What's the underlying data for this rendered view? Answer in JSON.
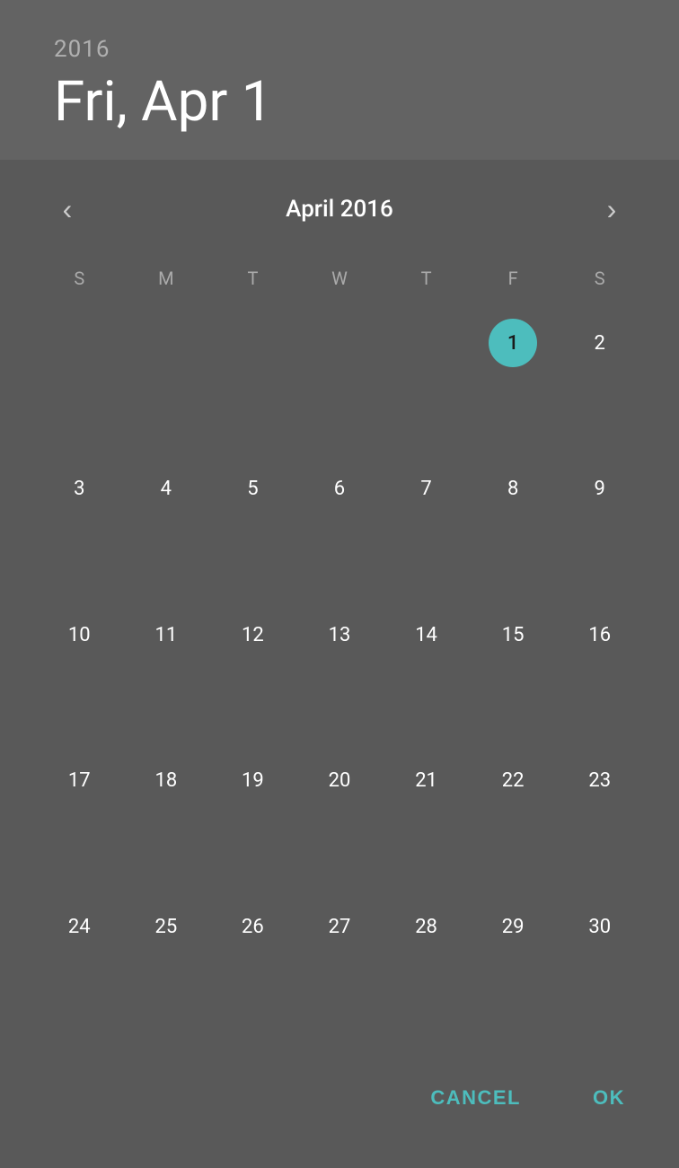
{
  "header": {
    "year": "2016",
    "date": "Fri, Apr 1"
  },
  "calendar": {
    "month_title": "April 2016",
    "day_headers": [
      "S",
      "M",
      "T",
      "W",
      "T",
      "F",
      "S"
    ],
    "prev_icon": "‹",
    "next_icon": "›",
    "selected_day": 1,
    "weeks": [
      [
        null,
        null,
        null,
        null,
        null,
        1,
        2
      ],
      [
        3,
        4,
        5,
        6,
        7,
        8,
        9
      ],
      [
        10,
        11,
        12,
        13,
        14,
        15,
        16
      ],
      [
        17,
        18,
        19,
        20,
        21,
        22,
        23
      ],
      [
        24,
        25,
        26,
        27,
        28,
        29,
        30
      ]
    ]
  },
  "footer": {
    "cancel_label": "CANCEL",
    "ok_label": "OK"
  }
}
